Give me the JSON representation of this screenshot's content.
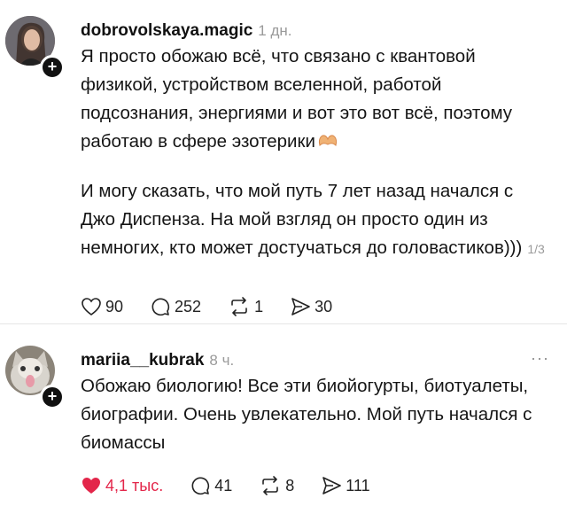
{
  "post1": {
    "username": "dobrovolskaya.magic",
    "time": "1 дн.",
    "paragraphs": [
      "Я просто обожаю всё, что связано с квантовой физикой, устройством вселенной, работой подсознания, энергиями и вот это вот всё, поэтому работаю в сфере эзотерики",
      "И могу сказать, что мой путь 7 лет назад начался с Джо Диспенза. На мой взгляд он просто один из немногих, кто может достучаться до головастиков)))"
    ],
    "page_indicator": "1/3",
    "likes": "90",
    "comments": "252",
    "reposts": "1",
    "shares": "30"
  },
  "post2": {
    "username": "mariia__kubrak",
    "time": "8 ч.",
    "more": "···",
    "paragraphs": [
      "Обожаю биологию! Все эти биойогурты, биотуалеты, биографии. Очень увлекательно. Мой путь начался с биомассы"
    ],
    "likes": "4,1 тыс.",
    "comments": "41",
    "reposts": "8",
    "shares": "111"
  },
  "colors": {
    "like_active": "#e3264a",
    "muted": "#9a9a9a"
  }
}
